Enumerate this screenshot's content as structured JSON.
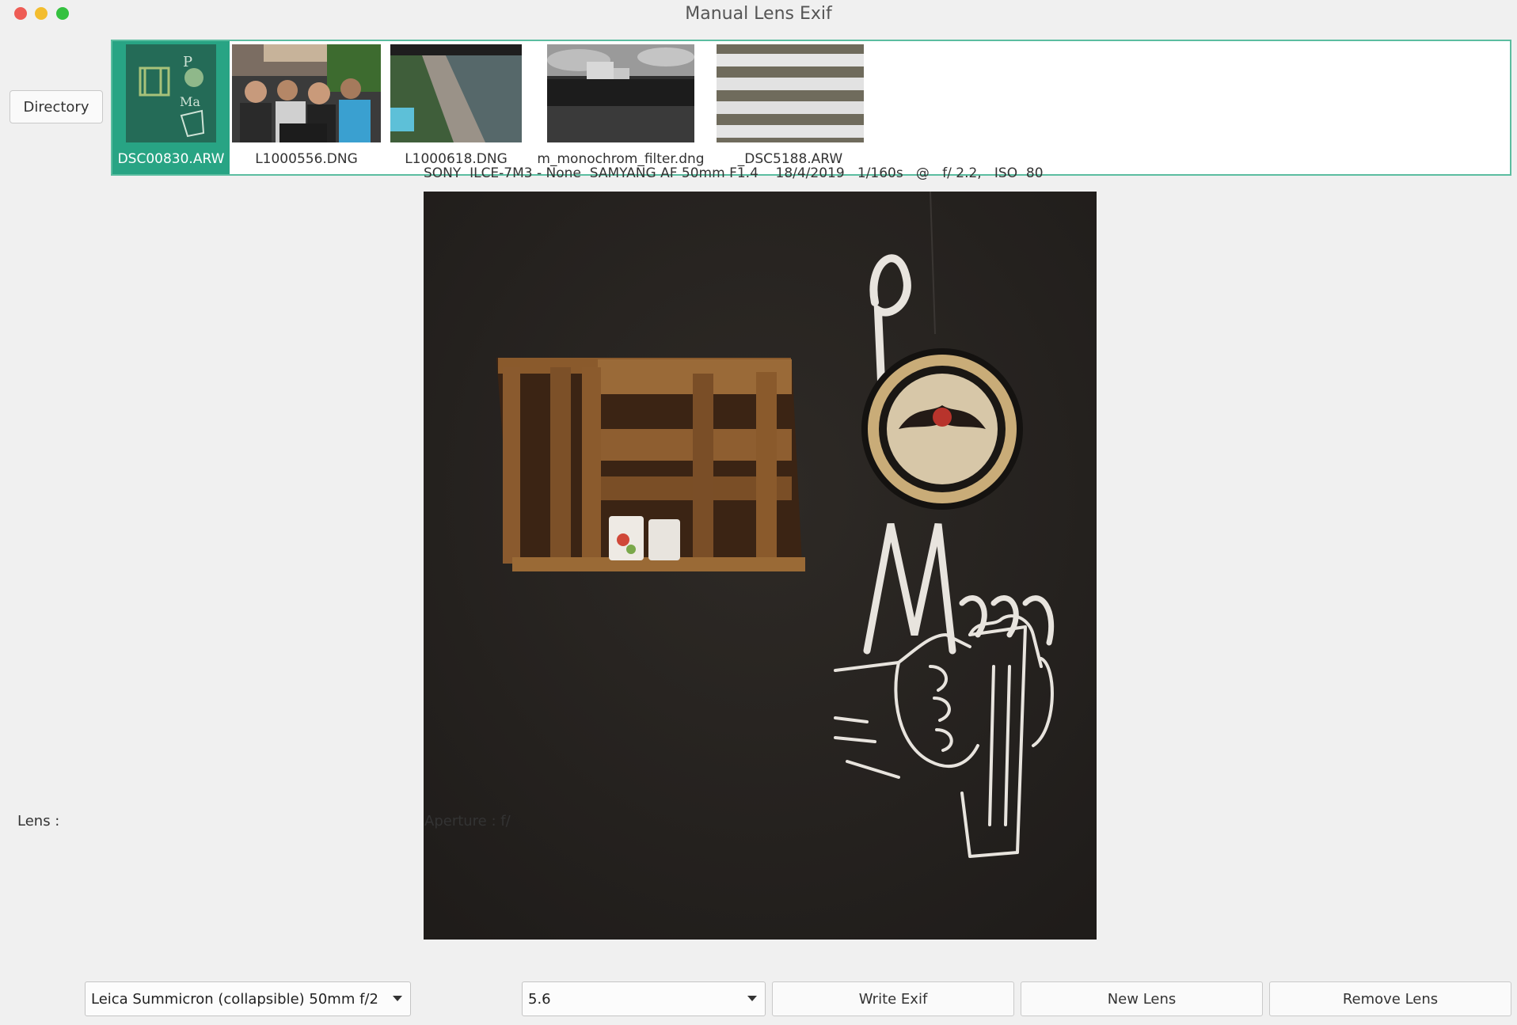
{
  "window": {
    "title": "Manual Lens Exif"
  },
  "toolbar": {
    "directory_label": "Directory"
  },
  "thumbnails": [
    {
      "filename": "DSC00830.ARW",
      "selected": true
    },
    {
      "filename": "L1000556.DNG",
      "selected": false
    },
    {
      "filename": "L1000618.DNG",
      "selected": false
    },
    {
      "filename": "m_monochrom_filter.dng",
      "selected": false
    },
    {
      "filename": "_DSC5188.ARW",
      "selected": false
    }
  ],
  "exif": {
    "line": "SONY  ILCE-7M3 - None  SAMYANG AF 50mm F1.4    18/4/2019   1/160s   @   f/ 2.2,   ISO  80"
  },
  "controls": {
    "lens_label": "Lens :",
    "lens_value": "Leica Summicron (collapsible) 50mm f/2",
    "aperture_label": "Aperture : f/",
    "aperture_value": "5.6",
    "write_label": "Write Exif",
    "new_lens_label": "New Lens",
    "remove_lens_label": "Remove Lens"
  },
  "colors": {
    "selection": "#28a484",
    "strip_border": "#5bbda0"
  }
}
